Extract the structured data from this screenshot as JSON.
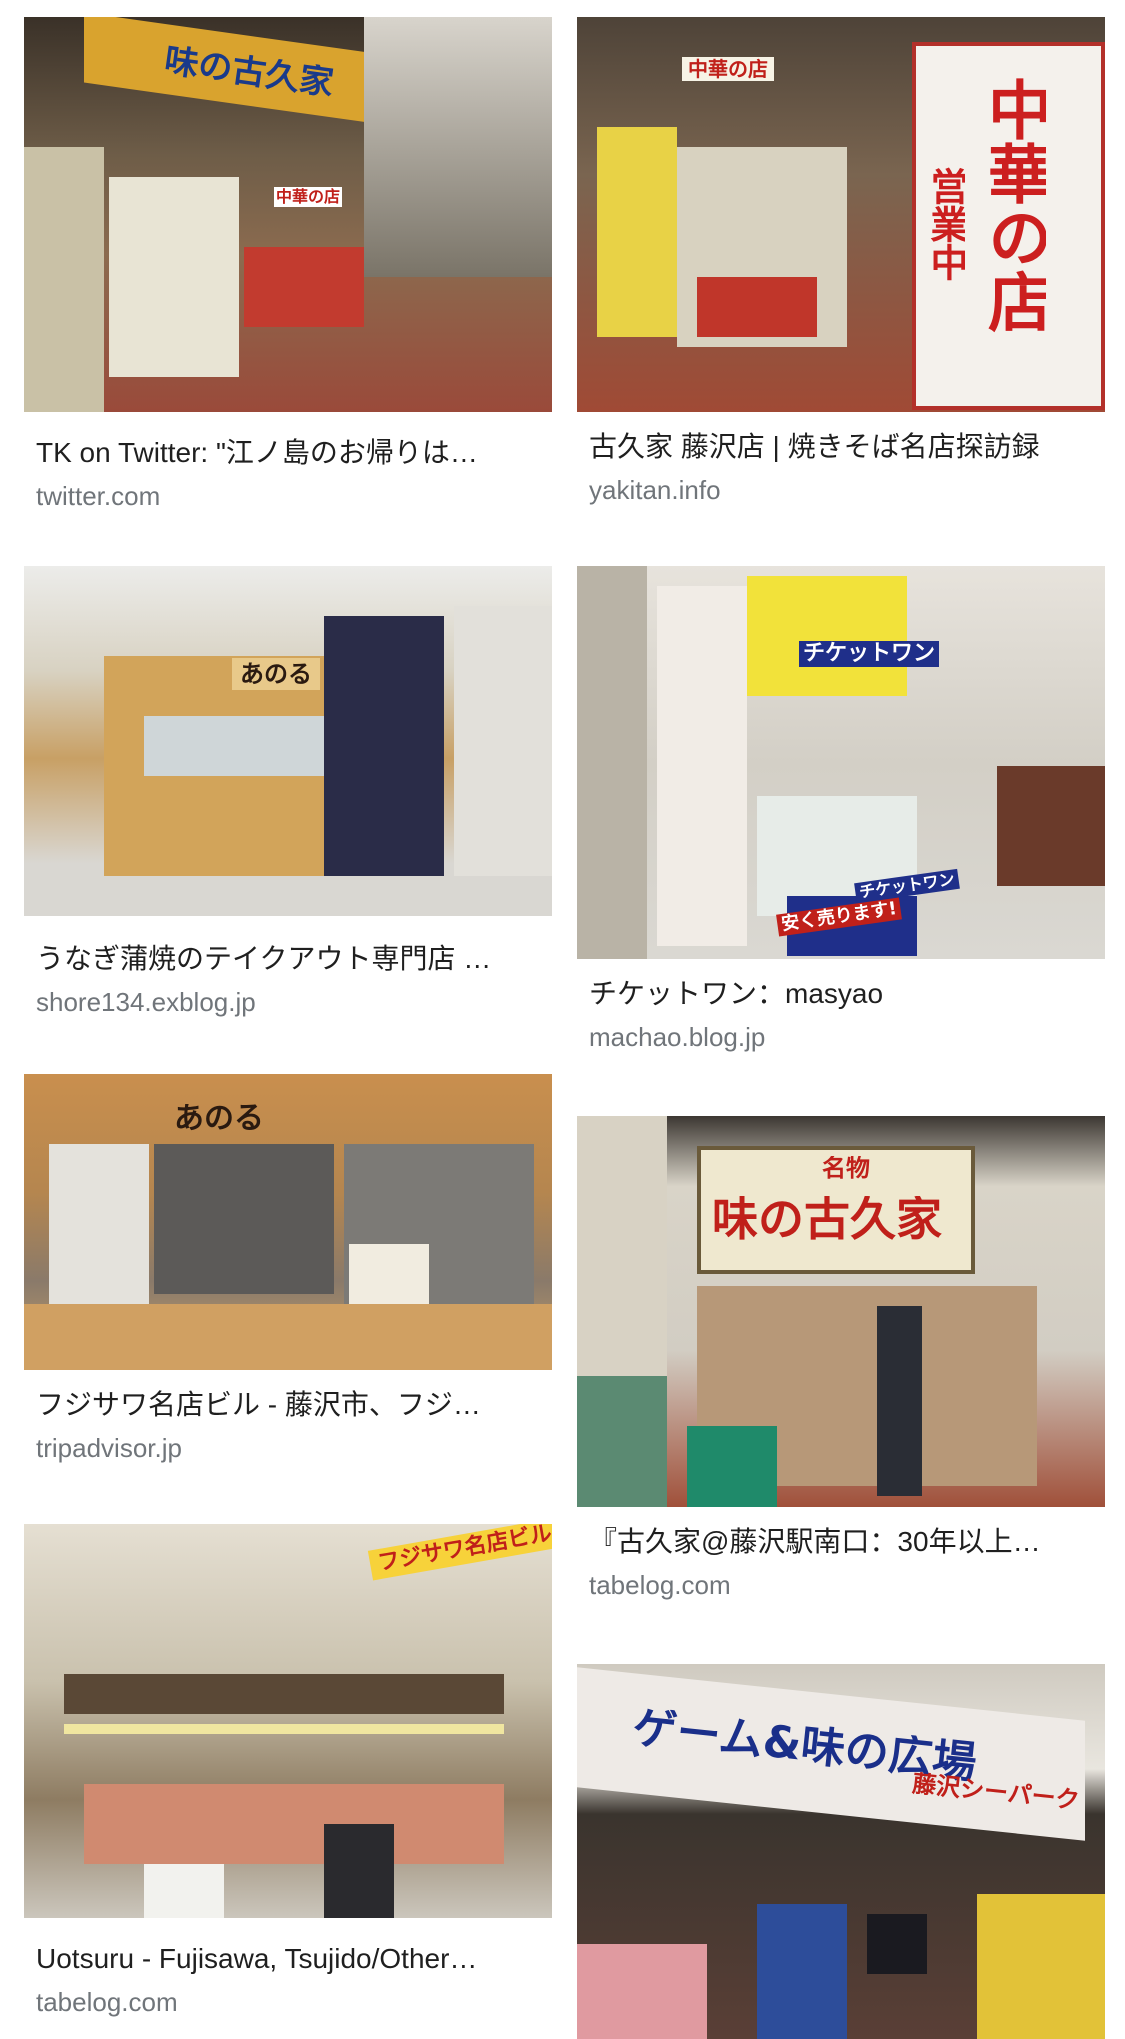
{
  "results": [
    {
      "title": "TK on Twitter: \"江ノ島のお帰りは…",
      "source": "twitter.com",
      "image_sign_1": "味の古久家",
      "image_sign_2": "中華の店"
    },
    {
      "title": "古久家 藤沢店 | 焼きそば名店探訪録",
      "source": "yakitan.info",
      "image_sign_1": "中華の店",
      "image_sign_2": "中華の店",
      "image_sign_3": "営業中"
    },
    {
      "title": "うなぎ蒲焼のテイクアウト専門店 …",
      "source": "shore134.exblog.jp",
      "image_sign_1": "あのる"
    },
    {
      "title": "チケットワン：masyao",
      "source": "machao.blog.jp",
      "image_sign_1": "チケットワン",
      "image_sign_2": "安く売ります!",
      "image_sign_3": "チケットワン"
    },
    {
      "title": "フジサワ名店ビル - 藤沢市、フジ…",
      "source": "tripadvisor.jp",
      "image_sign_1": "あのる"
    },
    {
      "title": "『古久家@藤沢駅南口：30年以上…",
      "source": "tabelog.com",
      "image_sign_1": "味の古久家",
      "image_sign_2": "名物"
    },
    {
      "title": "Uotsuru - Fujisawa, Tsujido/Other…",
      "source": "tabelog.com",
      "image_sign_1": "フジサワ名店ビル"
    },
    {
      "title": "",
      "source": "",
      "image_sign_1": "ゲーム&味の広場",
      "image_sign_2": "藤沢シーパーク"
    }
  ]
}
